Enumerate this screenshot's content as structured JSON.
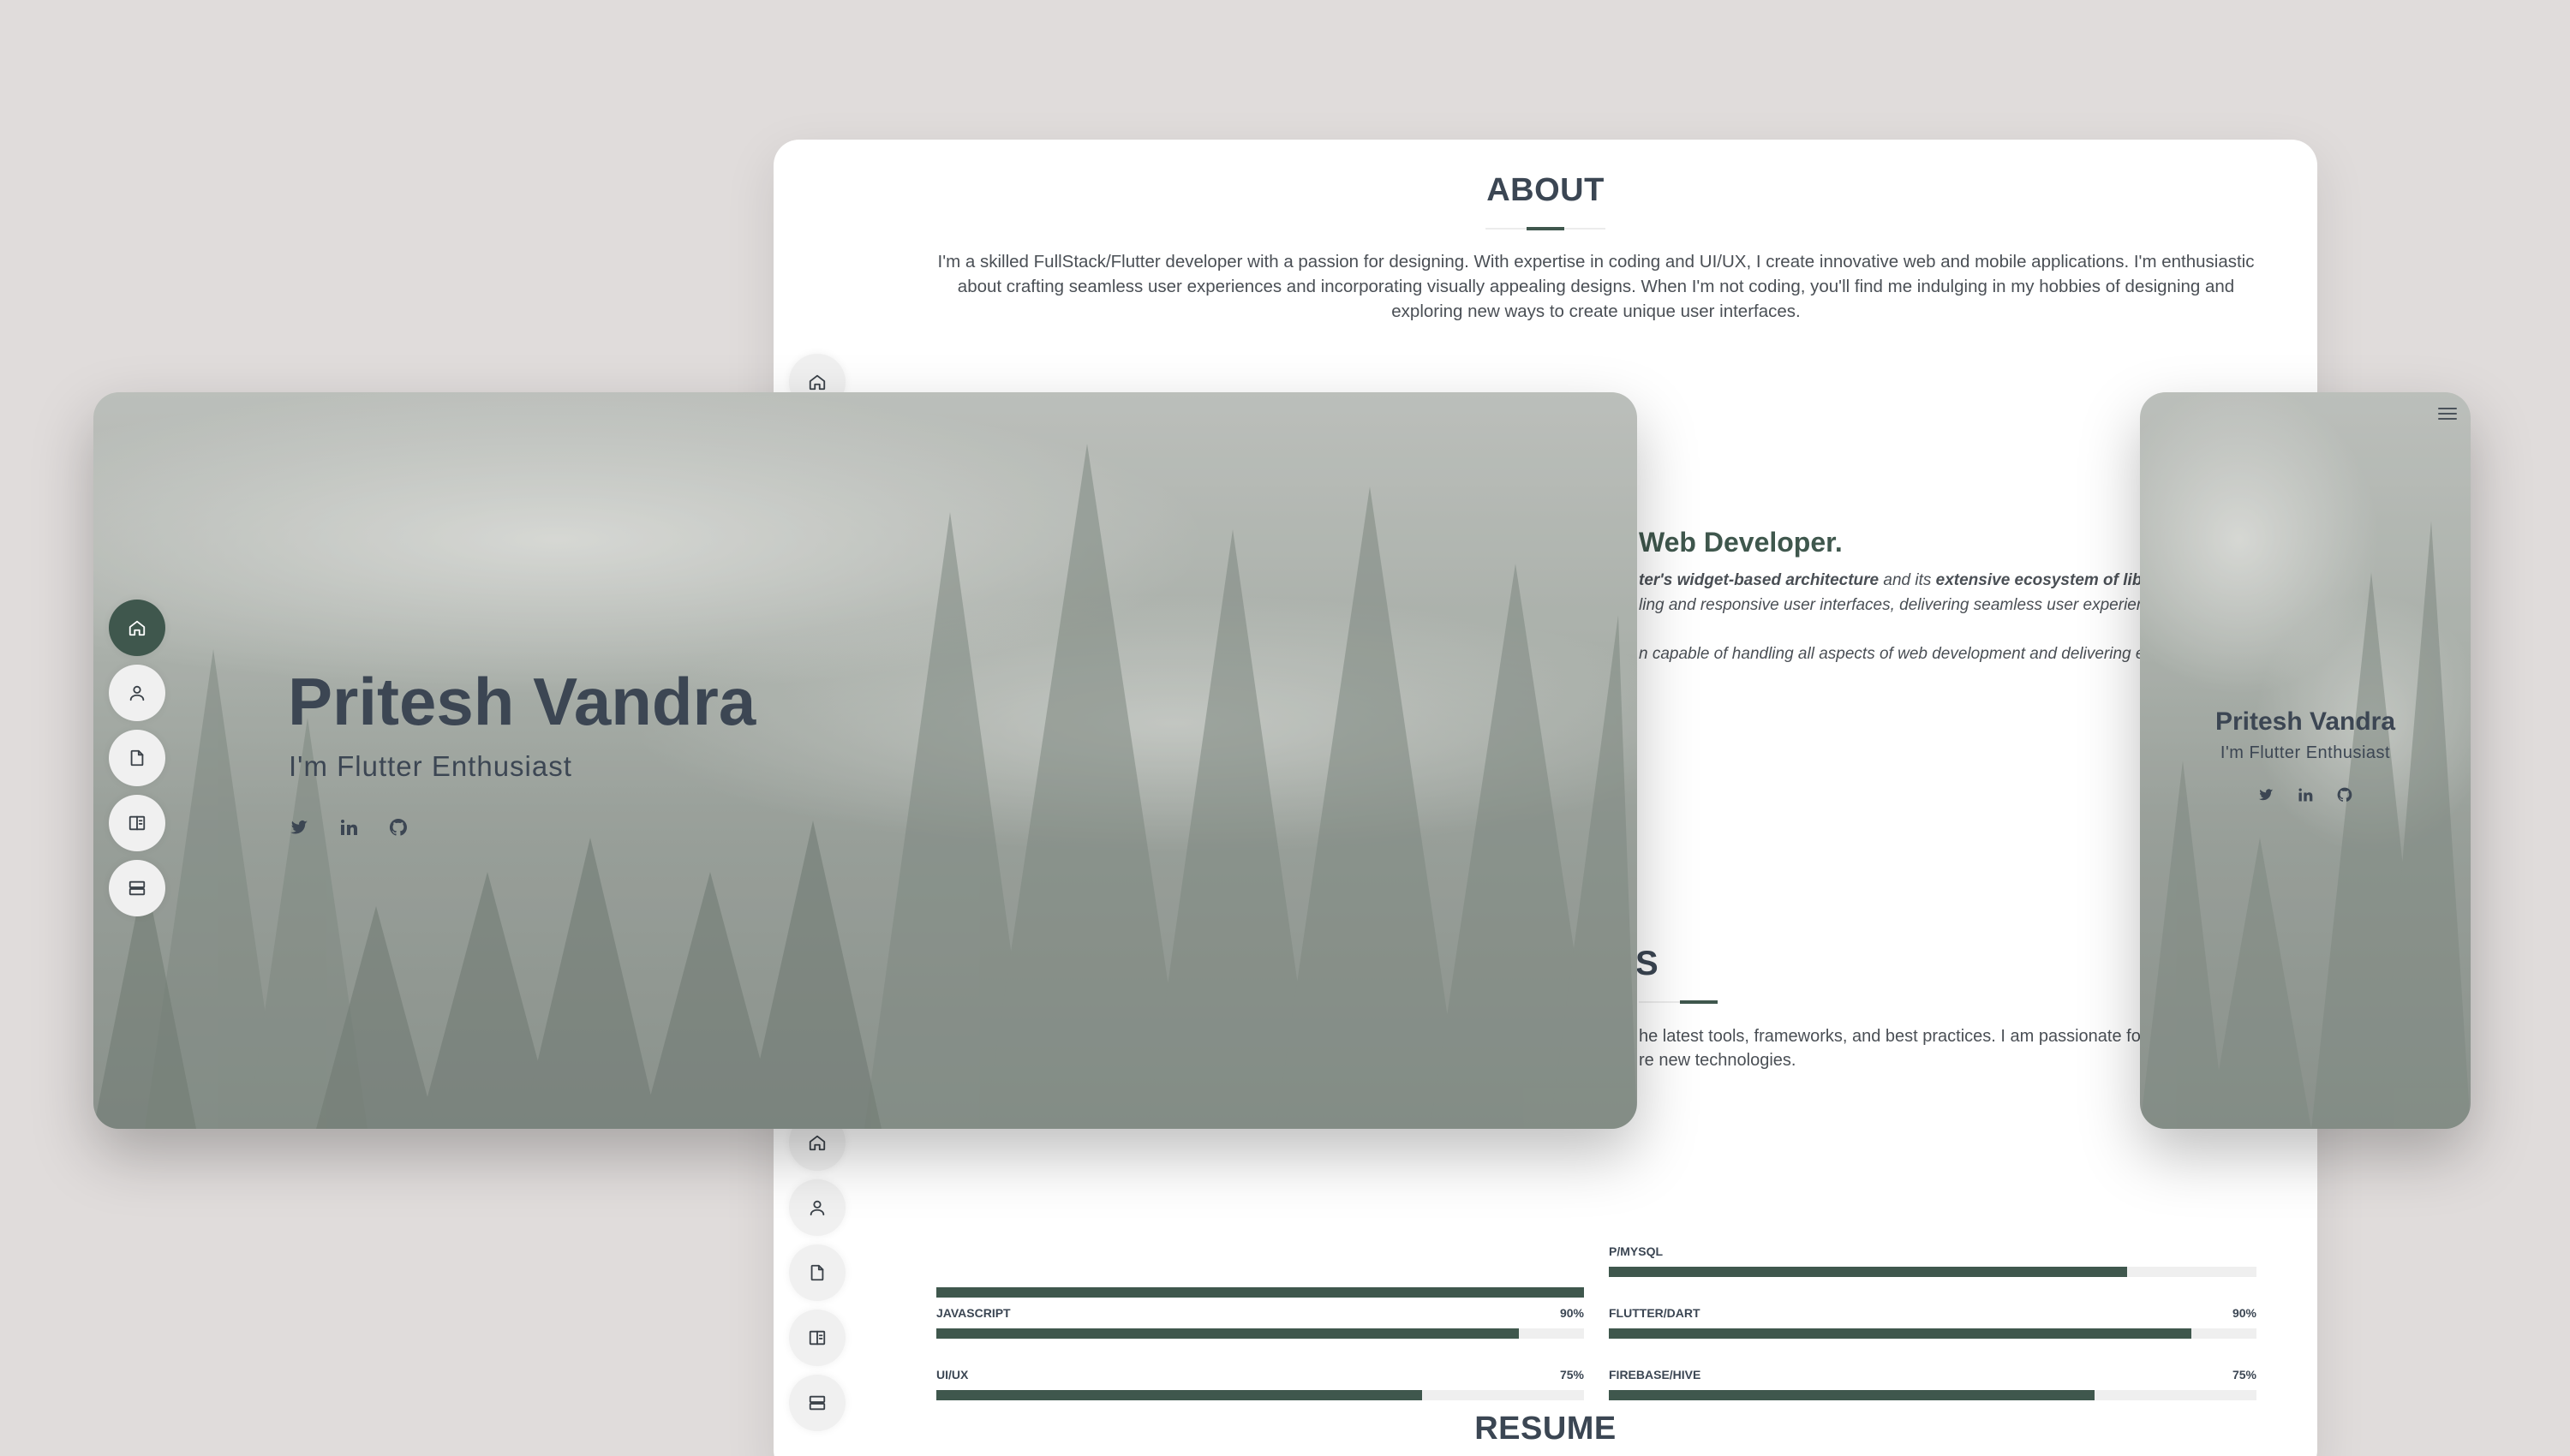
{
  "colors": {
    "background": "#e0dcdb",
    "accent": "#3f574d",
    "heading": "#3c4653",
    "card": "#ffffff"
  },
  "nav": {
    "items": [
      {
        "icon": "home-icon",
        "label": "Home"
      },
      {
        "icon": "user-icon",
        "label": "About"
      },
      {
        "icon": "file-icon",
        "label": "Resume"
      },
      {
        "icon": "book-icon",
        "label": "Portfolio"
      },
      {
        "icon": "server-icon",
        "label": "Services"
      }
    ]
  },
  "hero": {
    "name": "Pritesh Vandra",
    "tagline": "I'm Flutter Enthusiast",
    "socials": [
      "twitter-icon",
      "linkedin-icon",
      "github-icon"
    ]
  },
  "about": {
    "title": "ABOUT",
    "text": "I'm a skilled FullStack/Flutter developer with a passion for designing. With expertise in coding and UI/UX, I create innovative web and mobile applications. I'm enthusiastic about crafting seamless user experiences and incorporating visually appealing designs. When I'm not coding, you'll find me indulging in my hobbies of designing and exploring new ways to create unique user interfaces.",
    "role_title": "Web Developer.",
    "role_line1_a": "ter's widget-based architecture",
    "role_line1_b": " and its ",
    "role_line1_c": "extensive ecosystem of libr",
    "role_line2": "ling and responsive user interfaces, delivering seamless user experienc",
    "role_line3": "n capable of handling all aspects of web development and delivering e"
  },
  "skills": {
    "title_partial": "S",
    "text_line1": "he latest tools, frameworks, and best practices. I am passionate for",
    "text_line2": "re new technologies.",
    "items": [
      {
        "label": "JAVASCRIPT",
        "value": "90%",
        "percent": 90
      },
      {
        "label": "FLUTTER/DART",
        "value": "90%",
        "percent": 90
      },
      {
        "label": "UI/UX",
        "value": "75%",
        "percent": 75
      },
      {
        "label": "FIREBASE/HIVE",
        "value": "75%",
        "percent": 75
      }
    ],
    "partial_top_left_percent": 100,
    "partial_top_right_label": "P/MYSQL",
    "partial_top_right_percent": 80
  },
  "resume": {
    "title": "RESUME"
  },
  "mobile": {
    "name": "Pritesh Vandra",
    "tagline": "I'm Flutter Enthusiast",
    "menu_icon": "hamburger-icon"
  }
}
